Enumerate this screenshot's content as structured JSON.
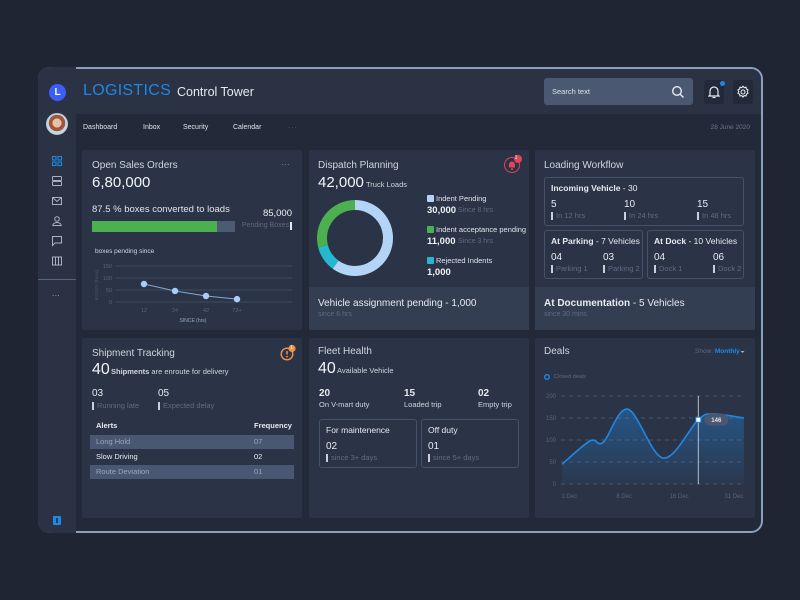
{
  "app": {
    "logo_letter": "L",
    "brand": "LOGISTICS",
    "title": "Control Tower"
  },
  "header": {
    "search_placeholder": "Search text",
    "notification_unread": true
  },
  "nav": {
    "items": [
      "Dashboard",
      "Inbox",
      "Security",
      "Calendar"
    ],
    "more": "...",
    "date": "28 June 2020"
  },
  "sidebar": {
    "items": [
      {
        "icon": "dashboard-grid-icon",
        "active": true
      },
      {
        "icon": "list-rows-icon",
        "active": false
      },
      {
        "icon": "mail-icon",
        "active": false
      },
      {
        "icon": "user-icon",
        "active": false
      },
      {
        "icon": "chat-icon",
        "active": false
      },
      {
        "icon": "columns-icon",
        "active": false
      }
    ],
    "more": "..."
  },
  "colors": {
    "accent": "#1e88e5",
    "green": "#4caf50",
    "light_blue": "#b3d4f7",
    "teal": "#26b8cf",
    "alert_red": "#e0455a",
    "alert_orange": "#f0914a"
  },
  "open_sales_orders": {
    "title": "Open Sales Orders",
    "more": "...",
    "value": "6,80,000",
    "conversion_text": "87.5 % boxes converted to loads",
    "conversion_percent": 87.5,
    "pending_value": "85,000",
    "pending_label": "Pending Boxes",
    "chart_title": "boxes pending since"
  },
  "dispatch_planning": {
    "title": "Dispatch Planning",
    "badge": "1",
    "value": "42,000",
    "unit": "Truck Loads",
    "legend": [
      {
        "label": "Indent Pending",
        "value": "30,000",
        "since": "Since 8 hrs",
        "color": "#b3d4f7"
      },
      {
        "label": "Indent acceptance pending",
        "value": "11,000",
        "since": "Since 3 hrs",
        "color": "#4caf50"
      },
      {
        "label": "Rejected Indents",
        "value": "1,000",
        "since": "",
        "color": "#26b8cf"
      }
    ],
    "footer": {
      "text": "Vehicle assignment pending - 1,000",
      "since": "since 6 hrs"
    }
  },
  "loading_workflow": {
    "title": "Loading Workflow",
    "incoming": {
      "label": "Incoming Vehicle",
      "count": " - 30",
      "stats": [
        {
          "value": "5",
          "label": "In 12 hrs"
        },
        {
          "value": "10",
          "label": "In 24 hrs"
        },
        {
          "value": "15",
          "label": "In 48 hrs"
        }
      ]
    },
    "parking": {
      "label": "At Parking",
      "count": " - 7 Vehicles",
      "stats": [
        {
          "value": "04",
          "label": "Parking 1"
        },
        {
          "value": "03",
          "label": "Parking 2"
        }
      ]
    },
    "dock": {
      "label": "At Dock",
      "count": " - 10 Vehicles",
      "stats": [
        {
          "value": "04",
          "label": "Dock 1"
        },
        {
          "value": "06",
          "label": "Dock 2"
        }
      ]
    },
    "footer": {
      "label": "At Documentation",
      "count": " - 5 Vehicles",
      "since": "since 30 mins"
    }
  },
  "shipment_tracking": {
    "title": "Shipment Tracking",
    "badge": "1",
    "count": "40",
    "text_bold": "Shipments",
    "text_rest": " are enroute for delivery",
    "stats": [
      {
        "value": "03",
        "label": "Running late"
      },
      {
        "value": "05",
        "label": "Expected delay"
      }
    ],
    "table": {
      "headers": [
        "Alerts",
        "Frequency"
      ],
      "rows": [
        {
          "alert": "Long Hold",
          "frequency": "07",
          "highlighted": true
        },
        {
          "alert": "Slow Driving",
          "frequency": "02",
          "highlighted": false
        },
        {
          "alert": "Route Deviation",
          "frequency": "01",
          "highlighted": true
        }
      ]
    }
  },
  "fleet_health": {
    "title": "Fleet Health",
    "count": "40",
    "label": "Available Vehicle",
    "stats": [
      {
        "value": "20",
        "label": "On V-mart duty"
      },
      {
        "value": "15",
        "label": "Loaded trip"
      },
      {
        "value": "02",
        "label": "Empty trip"
      }
    ],
    "boxes": [
      {
        "title": "For maintenence",
        "value": "02",
        "since": "since 3+ days"
      },
      {
        "title": "Off duty",
        "value": "01",
        "since": "since 5+ days"
      }
    ]
  },
  "deals": {
    "title": "Deals",
    "show_label": "Show:",
    "show_value": "Monthly",
    "legend": "Closed deals",
    "tooltip": "146"
  },
  "chart_data": [
    {
      "id": "boxes-pending",
      "type": "line",
      "title": "boxes pending since",
      "categories": [
        "12",
        "24",
        "42",
        "72+"
      ],
      "values": [
        75,
        46,
        25,
        12
      ],
      "xlabel": "SINCE (hrs)",
      "ylabel": "BOXES (thous)",
      "ylim": [
        0,
        150
      ],
      "yticks": [
        0,
        50,
        100,
        150
      ],
      "grid": true
    },
    {
      "id": "dispatch-donut",
      "type": "pie",
      "labels": [
        "Indent Pending",
        "Rejected Indents",
        "Indent acceptance pending"
      ],
      "values": [
        30000,
        1000,
        11000
      ],
      "shown_share_percent": [
        60,
        11,
        29
      ],
      "colors": [
        "#b3d4f7",
        "#26b8cf",
        "#4caf50"
      ]
    },
    {
      "id": "deals-area",
      "type": "area",
      "series": [
        {
          "name": "Closed deals",
          "x": [
            -0.13,
            0.38,
            0.62,
            1.07,
            1.71,
            2.35,
            2.62,
            3.18
          ],
          "values": [
            45,
            98,
            95,
            170,
            59,
            146,
            159,
            150
          ]
        }
      ],
      "x_tick_labels": [
        "1 Dec",
        "8 Dec",
        "16 Dec",
        "31 Dec"
      ],
      "x_ticks": [
        0,
        1,
        2,
        3
      ],
      "xlim": [
        -0.15,
        3.2
      ],
      "ylim": [
        0,
        200
      ],
      "yticks": [
        0,
        50,
        100,
        150,
        200
      ],
      "grid": true,
      "highlight": {
        "x": 2.35,
        "value": 146
      },
      "legend": "top-left"
    }
  ]
}
